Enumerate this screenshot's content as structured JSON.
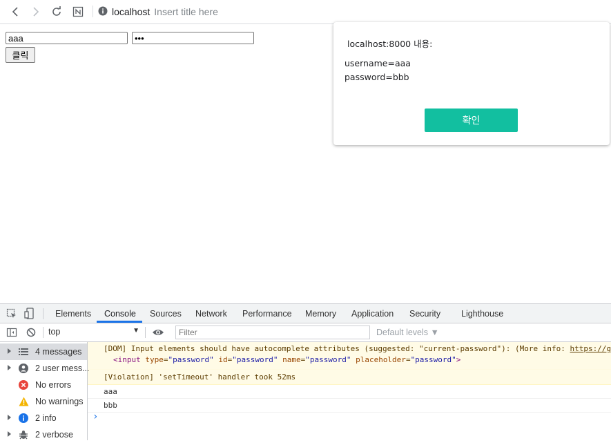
{
  "browser": {
    "url_host": "localhost",
    "title_placeholder": "Insert title here",
    "icons": [
      "back-icon",
      "forward-icon",
      "reload-icon",
      "extension-n-icon",
      "info-icon"
    ]
  },
  "page": {
    "username_value": "aaa",
    "password_value": "bbb",
    "button_label": "클릭"
  },
  "dialog": {
    "title": "localhost:8000 내용:",
    "lines": [
      "username=aaa",
      "password=bbb"
    ],
    "ok_label": "확인",
    "ok_color": "#12bfa0"
  },
  "devtools": {
    "tabs": [
      "Elements",
      "Console",
      "Sources",
      "Network",
      "Performance",
      "Memory",
      "Application",
      "Security",
      "Lighthouse"
    ],
    "active_tab": "Console",
    "context": "top",
    "filter_placeholder": "Filter",
    "levels": "Default levels ▼",
    "sidebar": [
      {
        "label": "4 messages",
        "icon": "list-icon"
      },
      {
        "label": "2 user mess...",
        "icon": "user-icon"
      },
      {
        "label": "No errors",
        "icon": "error-icon"
      },
      {
        "label": "No warnings",
        "icon": "warning-icon"
      },
      {
        "label": "2 info",
        "icon": "info-icon"
      },
      {
        "label": "2 verbose",
        "icon": "bug-icon"
      }
    ],
    "messages": {
      "dom_warning": "[DOM] Input elements should have autocomplete attributes (suggested: \"current-password\"): (More info: ",
      "dom_link": "https://goo",
      "element_snippet": {
        "tag_open": "<input",
        "type_attr": "type",
        "type_val": "\"password\"",
        "id_attr": "id",
        "id_val": "\"password\"",
        "name_attr": "name",
        "name_val": "\"password\"",
        "placeholder_attr": "placeholder",
        "placeholder_val": "\"password\"",
        "tag_close": ">"
      },
      "violation": "[Violation] 'setTimeout' handler took 52ms",
      "log1": "aaa",
      "log2": "bbb",
      "prompt": "›"
    }
  }
}
